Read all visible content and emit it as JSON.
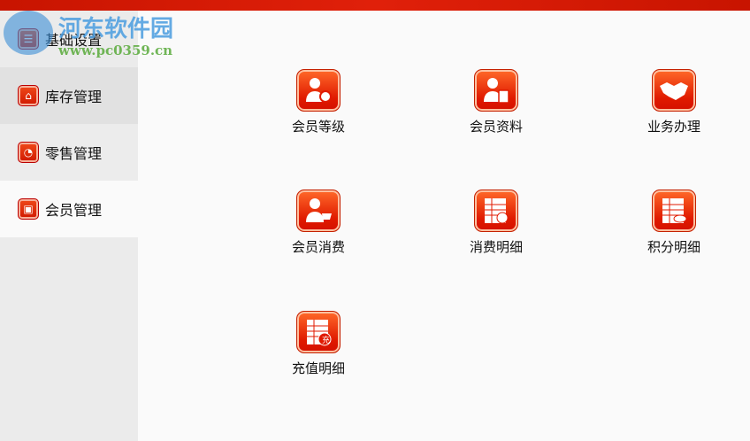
{
  "sidebar": {
    "items": [
      {
        "label": "基础设置",
        "icon": "settings-icon"
      },
      {
        "label": "库存管理",
        "icon": "warehouse-icon"
      },
      {
        "label": "零售管理",
        "icon": "pie-chart-icon"
      },
      {
        "label": "会员管理",
        "icon": "member-card-icon",
        "active": true
      }
    ]
  },
  "main": {
    "tiles": [
      {
        "label": "会员等级",
        "icon": "member-level-icon"
      },
      {
        "label": "会员资料",
        "icon": "member-info-icon"
      },
      {
        "label": "业务办理",
        "icon": "handshake-icon"
      },
      {
        "label": "会员消费",
        "icon": "member-consume-icon"
      },
      {
        "label": "消费明细",
        "icon": "consume-detail-icon"
      },
      {
        "label": "积分明细",
        "icon": "points-detail-icon"
      },
      {
        "label": "充值明细",
        "icon": "recharge-detail-icon",
        "badge": "充"
      }
    ]
  },
  "watermark": {
    "name": "河东软件园",
    "url": "www.pc0359.cn"
  },
  "colors": {
    "accent": "#e01a00",
    "topbar": "#d01800"
  }
}
